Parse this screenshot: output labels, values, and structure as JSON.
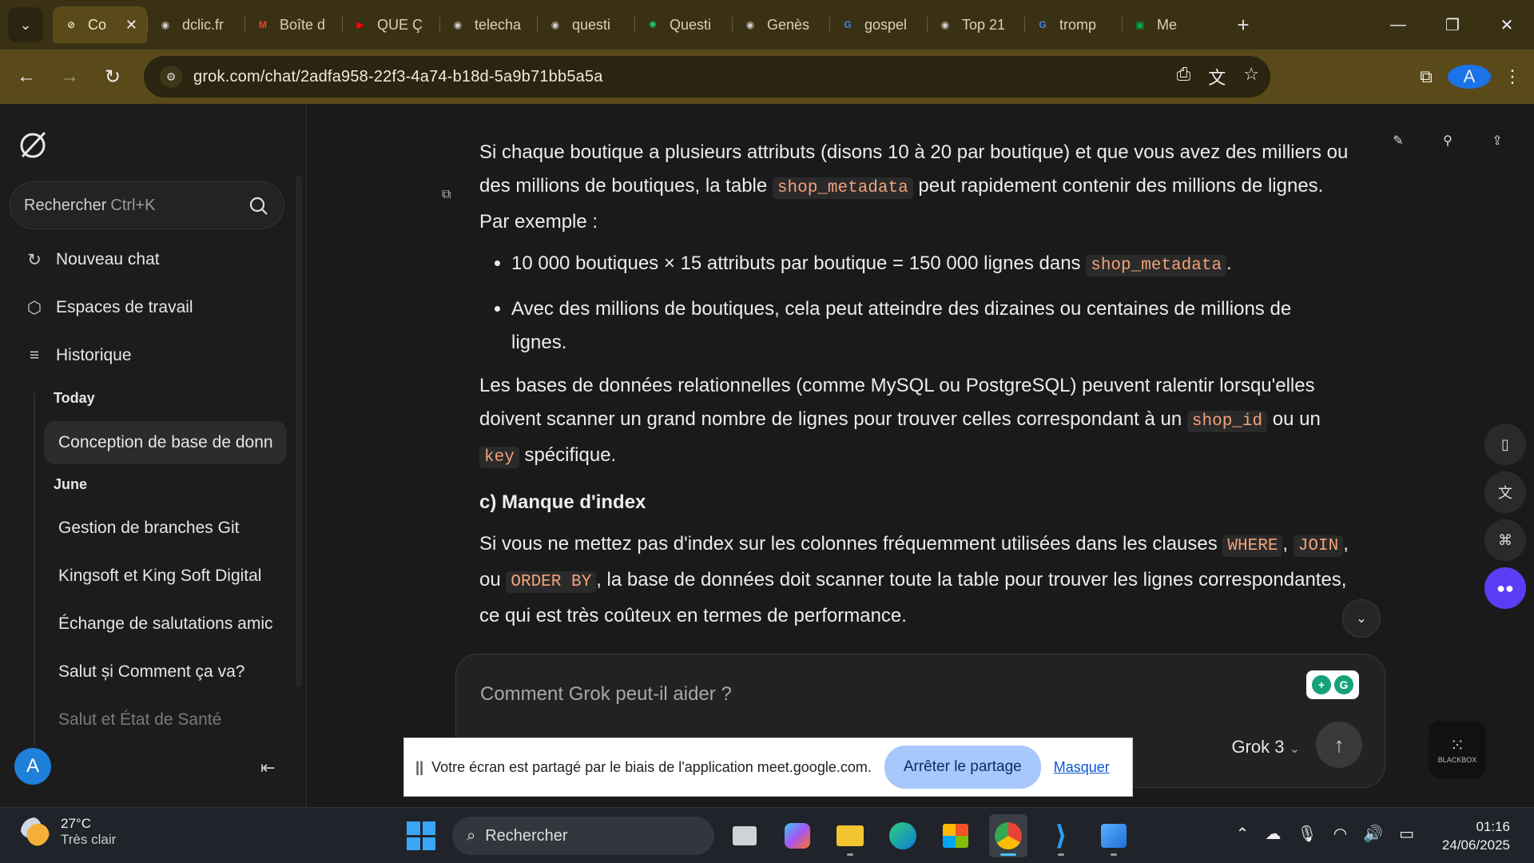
{
  "browser": {
    "tabs": [
      {
        "label": "Co",
        "icon": "grok-icon",
        "color": "#f0e8d0",
        "active": true
      },
      {
        "label": "dclic.fr",
        "icon": "globe-icon",
        "color": "#cfcfcf"
      },
      {
        "label": "Boîte d",
        "icon": "gmail-icon",
        "color": "#ea4335"
      },
      {
        "label": "QUE Ç",
        "icon": "youtube-icon",
        "color": "#ff0000"
      },
      {
        "label": "telecha",
        "icon": "globe-icon",
        "color": "#cfcfcf"
      },
      {
        "label": "questi",
        "icon": "globe-icon",
        "color": "#cfcfcf"
      },
      {
        "label": "Questi",
        "icon": "chatgpt-icon",
        "color": "#19c37d"
      },
      {
        "label": "Genès",
        "icon": "globe-icon",
        "color": "#cfcfcf"
      },
      {
        "label": "gospel",
        "icon": "google-icon",
        "color": "#4285f4"
      },
      {
        "label": "Top 21",
        "icon": "globe-icon",
        "color": "#cfcfcf"
      },
      {
        "label": "tromp",
        "icon": "google-icon",
        "color": "#4285f4"
      },
      {
        "label": "Me",
        "icon": "meet-icon",
        "color": "#00ac47"
      }
    ],
    "url": "grok.com/chat/2adfa958-22f3-4a74-b18d-5a9b71bb5a5a",
    "profile_initial": "A"
  },
  "sidebar": {
    "search_label": "Rechercher",
    "search_shortcut": "Ctrl+K",
    "nav": [
      {
        "label": "Nouveau chat"
      },
      {
        "label": "Espaces de travail"
      },
      {
        "label": "Historique"
      }
    ],
    "groups": {
      "today": "Today",
      "june": "June"
    },
    "history_today": [
      "Conception de base de donn"
    ],
    "history_june": [
      "Gestion de branches Git",
      "Kingsoft et King Soft Digital",
      "Échange de salutations amic",
      "Salut și Comment ça va?",
      "Salut et État de Santé"
    ],
    "avatar_initial": "A"
  },
  "chat": {
    "p1_a": "Si chaque boutique a plusieurs attributs (disons 10 à 20 par boutique) et que vous avez des milliers ou des millions de boutiques, la table ",
    "p1_code": "shop_metadata",
    "p1_b": " peut rapidement contenir des millions de lignes. Par exemple :",
    "li1_a": "10 000 boutiques × 15 attributs par boutique = 150 000 lignes dans ",
    "li1_code": "shop_metadata",
    "li1_b": ".",
    "li2": "Avec des millions de boutiques, cela peut atteindre des dizaines ou centaines de millions de lignes.",
    "p2_a": "Les bases de données relationnelles (comme MySQL ou PostgreSQL) peuvent ralentir lorsqu'elles doivent scanner un grand nombre de lignes pour trouver celles correspondant à un ",
    "p2_code1": "shop_id",
    "p2_b": " ou un ",
    "p2_code2": "key",
    "p2_c": " spécifique.",
    "h_c": "c) Manque d'index",
    "p3_a": "Si vous ne mettez pas d'index sur les colonnes fréquemment utilisées dans les clauses ",
    "p3_code1": "WHERE",
    "p3_b": ", ",
    "p3_code2": "JOIN",
    "p3_c": ", ou ",
    "p3_code3": "ORDER BY",
    "p3_d": ", la base de données doit scanner toute la table pour trouver les lignes correspondantes, ce qui est très coûteux en termes de performance."
  },
  "composer": {
    "placeholder": "Comment Grok peut-il aider ?",
    "model": "Grok 3"
  },
  "share_banner": {
    "message": "Votre écran est partagé par le biais de l'application meet.google.com.",
    "stop": "Arrêter le partage",
    "hide": "Masquer"
  },
  "extensions": {
    "blackbox": "BLACKBOX"
  },
  "taskbar": {
    "temp": "27°C",
    "weather": "Très clair",
    "search": "Rechercher",
    "time": "01:16",
    "date": "24/06/2025"
  }
}
